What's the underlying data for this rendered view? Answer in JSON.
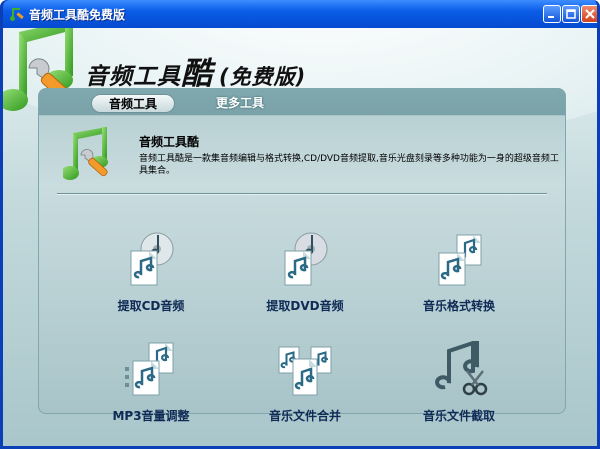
{
  "window": {
    "title": "音频工具酷免费版"
  },
  "brand": {
    "part1": "音频工具",
    "part2": "酷",
    "free": "(免费版)"
  },
  "tabs": [
    {
      "label": "音频工具",
      "active": true
    },
    {
      "label": "更多工具",
      "active": false
    }
  ],
  "info": {
    "title": "音频工具酷",
    "description": "音频工具酷是一款集音频编辑与格式转换,CD/DVD音频提取,音乐光盘刻录等多种功能为一身的超级音频工具集合。"
  },
  "tools": [
    {
      "label": "提取CD音频",
      "icon": "cd-rip-icon"
    },
    {
      "label": "提取DVD音频",
      "icon": "dvd-rip-icon"
    },
    {
      "label": "音乐格式转换",
      "icon": "format-convert-icon"
    },
    {
      "label": "MP3音量调整",
      "icon": "volume-adjust-icon"
    },
    {
      "label": "音乐文件合并",
      "icon": "merge-icon"
    },
    {
      "label": "音乐文件截取",
      "icon": "cut-icon"
    }
  ],
  "colors": {
    "titlebar": "#0a5ce6",
    "accent_green": "#3fae2a",
    "label_text": "#0f2a55"
  }
}
